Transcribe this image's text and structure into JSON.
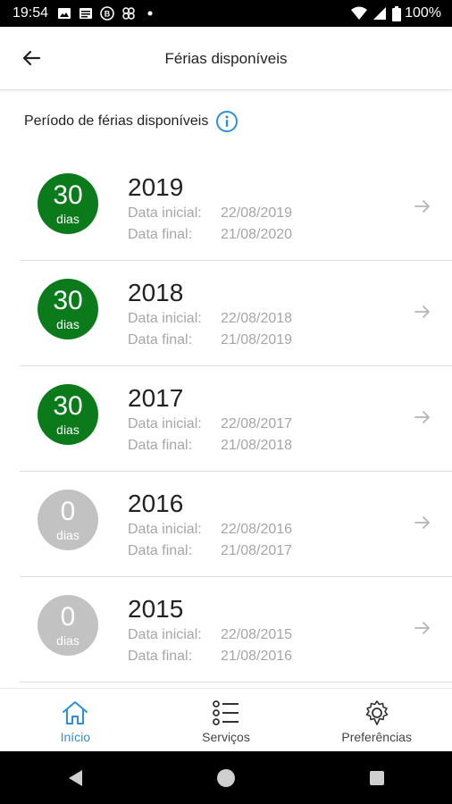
{
  "status_bar": {
    "time": "19:54",
    "battery": "100%",
    "notification_icons": [
      "image-icon",
      "news-icon",
      "brand-b-icon",
      "pinwheel-icon",
      "dot-icon"
    ],
    "system_icons": [
      "wifi-icon",
      "signal-icon",
      "battery-icon"
    ]
  },
  "app_bar": {
    "title": "Férias disponíveis",
    "back_icon": "arrow-left-icon"
  },
  "section": {
    "title": "Período de férias disponíveis",
    "info_icon": "info-circle-icon"
  },
  "labels": {
    "start": "Data inicial:",
    "end": "Data final:"
  },
  "periods": [
    {
      "days": "30",
      "unit": "dias",
      "year": "2019",
      "start": "22/08/2019",
      "end": "21/08/2020",
      "status": "active"
    },
    {
      "days": "30",
      "unit": "dias",
      "year": "2018",
      "start": "22/08/2018",
      "end": "21/08/2019",
      "status": "active"
    },
    {
      "days": "30",
      "unit": "dias",
      "year": "2017",
      "start": "22/08/2017",
      "end": "21/08/2018",
      "status": "active"
    },
    {
      "days": "0",
      "unit": "dias",
      "year": "2016",
      "start": "22/08/2016",
      "end": "21/08/2017",
      "status": "inactive"
    },
    {
      "days": "0",
      "unit": "dias",
      "year": "2015",
      "start": "22/08/2015",
      "end": "21/08/2016",
      "status": "inactive"
    }
  ],
  "colors": {
    "active_badge": "#0a7a1b",
    "inactive_badge": "#c2c2c2",
    "accent": "#2d8fd8"
  },
  "bottom_nav": [
    {
      "label": "Início",
      "icon": "home-icon",
      "active": true
    },
    {
      "label": "Serviços",
      "icon": "list-icon",
      "active": false
    },
    {
      "label": "Preferências",
      "icon": "gear-icon",
      "active": false
    }
  ],
  "system_nav": [
    "back-triangle-icon",
    "home-circle-icon",
    "recents-square-icon"
  ]
}
